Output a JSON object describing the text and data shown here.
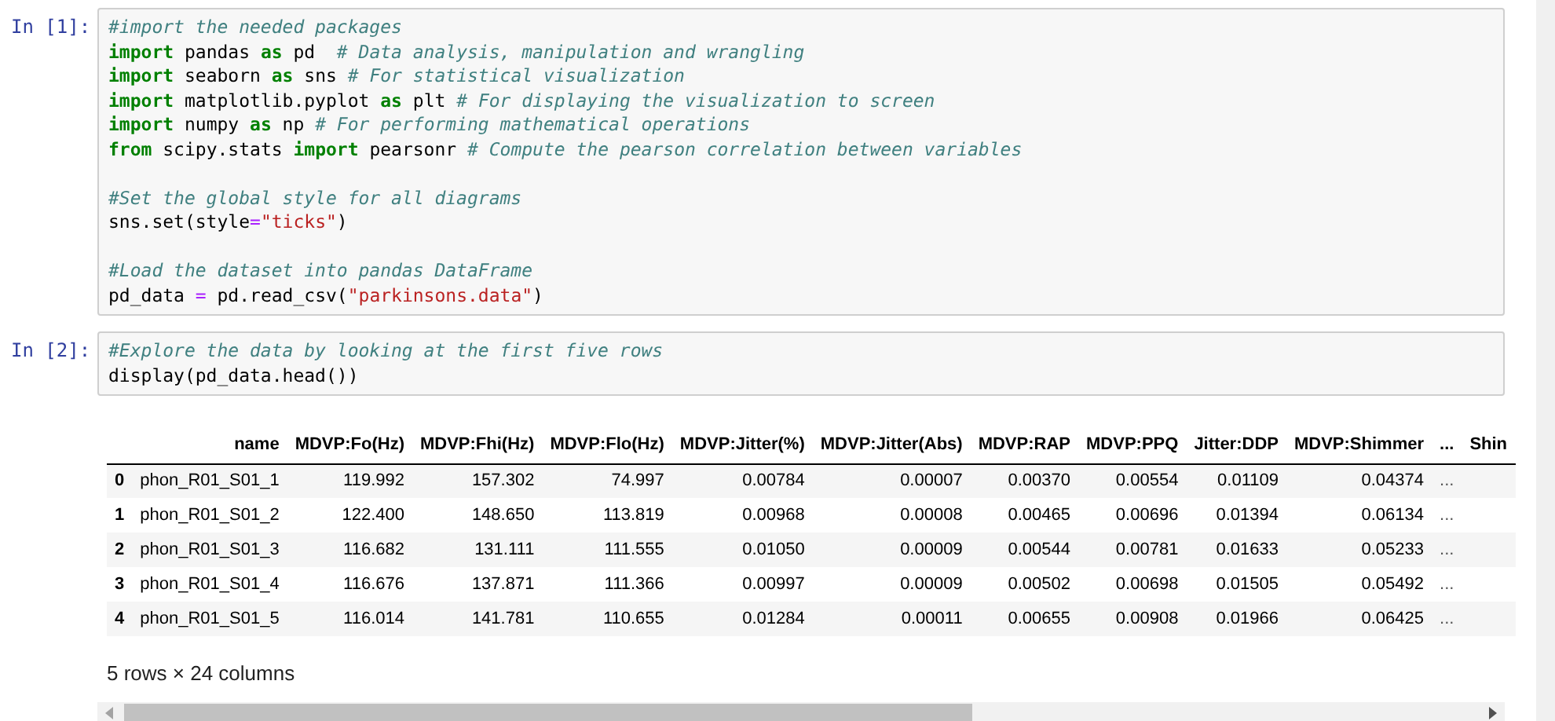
{
  "cells": [
    {
      "prompt": "In [1]:",
      "blocks": [
        [
          [
            {
              "kind": "comment",
              "text": "#import the needed packages"
            }
          ],
          [
            {
              "kind": "keyword",
              "text": "import"
            },
            {
              "kind": "plain",
              "text": " pandas "
            },
            {
              "kind": "keyword",
              "text": "as"
            },
            {
              "kind": "plain",
              "text": " pd  "
            },
            {
              "kind": "comment",
              "text": "# Data analysis, manipulation and wrangling"
            }
          ],
          [
            {
              "kind": "keyword",
              "text": "import"
            },
            {
              "kind": "plain",
              "text": " seaborn "
            },
            {
              "kind": "keyword",
              "text": "as"
            },
            {
              "kind": "plain",
              "text": " sns "
            },
            {
              "kind": "comment",
              "text": "# For statistical visualization"
            }
          ],
          [
            {
              "kind": "keyword",
              "text": "import"
            },
            {
              "kind": "plain",
              "text": " matplotlib.pyplot "
            },
            {
              "kind": "keyword",
              "text": "as"
            },
            {
              "kind": "plain",
              "text": " plt "
            },
            {
              "kind": "comment",
              "text": "# For displaying the visualization to screen"
            }
          ],
          [
            {
              "kind": "keyword",
              "text": "import"
            },
            {
              "kind": "plain",
              "text": " numpy "
            },
            {
              "kind": "keyword",
              "text": "as"
            },
            {
              "kind": "plain",
              "text": " np "
            },
            {
              "kind": "comment",
              "text": "# For performing mathematical operations"
            }
          ],
          [
            {
              "kind": "keyword",
              "text": "from"
            },
            {
              "kind": "plain",
              "text": " scipy.stats "
            },
            {
              "kind": "keyword",
              "text": "import"
            },
            {
              "kind": "plain",
              "text": " pearsonr "
            },
            {
              "kind": "comment",
              "text": "# Compute the pearson correlation between variables"
            }
          ]
        ],
        [
          [
            {
              "kind": "comment",
              "text": "#Set the global style for all diagrams"
            }
          ],
          [
            {
              "kind": "plain",
              "text": "sns.set(style"
            },
            {
              "kind": "operator",
              "text": "="
            },
            {
              "kind": "string",
              "text": "\"ticks\""
            },
            {
              "kind": "plain",
              "text": ")"
            }
          ]
        ],
        [
          [
            {
              "kind": "comment",
              "text": "#Load the dataset into pandas DataFrame"
            }
          ],
          [
            {
              "kind": "plain",
              "text": "pd_data "
            },
            {
              "kind": "operator",
              "text": "="
            },
            {
              "kind": "plain",
              "text": " pd.read_csv("
            },
            {
              "kind": "string",
              "text": "\"parkinsons.data\""
            },
            {
              "kind": "plain",
              "text": ")"
            }
          ]
        ]
      ]
    },
    {
      "prompt": "In [2]:",
      "blocks": [
        [
          [
            {
              "kind": "comment",
              "text": "#Explore the data by looking at the first five rows"
            }
          ],
          [
            {
              "kind": "plain",
              "text": "display(pd_data.head())"
            }
          ]
        ]
      ]
    }
  ],
  "table": {
    "columns": [
      "name",
      "MDVP:Fo(Hz)",
      "MDVP:Fhi(Hz)",
      "MDVP:Flo(Hz)",
      "MDVP:Jitter(%)",
      "MDVP:Jitter(Abs)",
      "MDVP:RAP",
      "MDVP:PPQ",
      "Jitter:DDP",
      "MDVP:Shimmer",
      "...",
      "Shin"
    ],
    "rows": [
      {
        "index": "0",
        "cells": [
          "phon_R01_S01_1",
          "119.992",
          "157.302",
          "74.997",
          "0.00784",
          "0.00007",
          "0.00370",
          "0.00554",
          "0.01109",
          "0.04374",
          "..."
        ]
      },
      {
        "index": "1",
        "cells": [
          "phon_R01_S01_2",
          "122.400",
          "148.650",
          "113.819",
          "0.00968",
          "0.00008",
          "0.00465",
          "0.00696",
          "0.01394",
          "0.06134",
          "..."
        ]
      },
      {
        "index": "2",
        "cells": [
          "phon_R01_S01_3",
          "116.682",
          "131.111",
          "111.555",
          "0.01050",
          "0.00009",
          "0.00544",
          "0.00781",
          "0.01633",
          "0.05233",
          "..."
        ]
      },
      {
        "index": "3",
        "cells": [
          "phon_R01_S01_4",
          "116.676",
          "137.871",
          "111.366",
          "0.00997",
          "0.00009",
          "0.00502",
          "0.00698",
          "0.01505",
          "0.05492",
          "..."
        ]
      },
      {
        "index": "4",
        "cells": [
          "phon_R01_S01_5",
          "116.014",
          "141.781",
          "110.655",
          "0.01284",
          "0.00011",
          "0.00655",
          "0.00908",
          "0.01966",
          "0.06425",
          "..."
        ]
      }
    ],
    "footer": "5 rows × 24 columns"
  }
}
